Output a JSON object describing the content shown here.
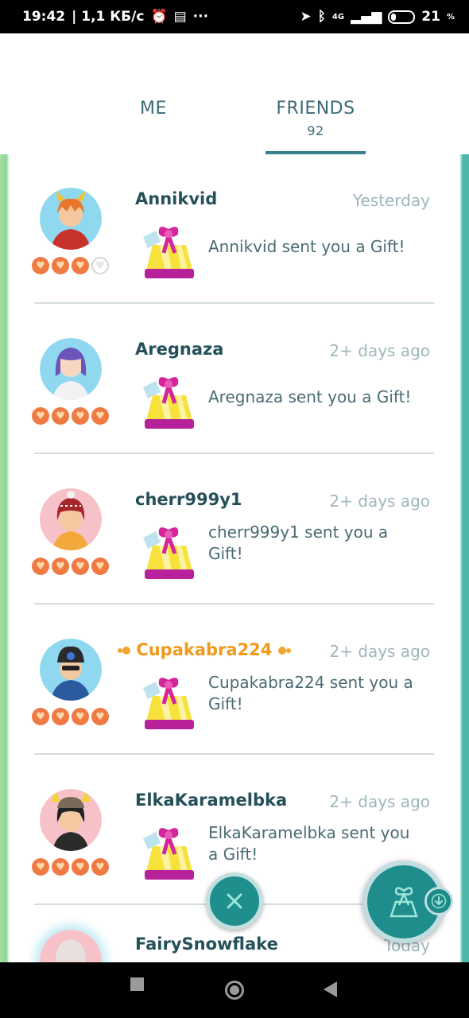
{
  "status_bar": {
    "time": "19:42",
    "speed": "| 1,1 КБ/с",
    "more": "···",
    "network": "4G",
    "battery": "21"
  },
  "tabs": {
    "me": "ME",
    "friends": "FRIENDS",
    "friends_count": "92"
  },
  "friends": [
    {
      "name": "Annikvid",
      "time": "Yesterday",
      "message": "Annikvid sent you a Gift!",
      "hearts_filled": 3,
      "hearts_total": 4,
      "name_color": "#24505a"
    },
    {
      "name": "Aregnaza",
      "time": "2+ days ago",
      "message": "Aregnaza sent you a Gift!",
      "hearts_filled": 4,
      "hearts_total": 4,
      "name_color": "#24505a"
    },
    {
      "name": "cherr999y1",
      "time": "2+ days ago",
      "message": "cherr999y1 sent you a Gift!",
      "hearts_filled": 4,
      "hearts_total": 4,
      "name_color": "#24505a"
    },
    {
      "name": "Cupakabra224",
      "time": "2+ days ago",
      "message": "Cupakabra224 sent you a Gift!",
      "hearts_filled": 4,
      "hearts_total": 4,
      "name_color": "#f09a1c"
    },
    {
      "name": "ElkaKaramelbka",
      "time": "2+ days ago",
      "message": "ElkaKaramelbka sent you a Gift!",
      "hearts_filled": 4,
      "hearts_total": 4,
      "name_color": "#24505a"
    },
    {
      "name": "FairySnowflake",
      "time": "Today"
    }
  ],
  "icons": {
    "close_button": "close-icon",
    "gift_button": "gift-bow-icon",
    "download_badge": "download-arrow-icon"
  },
  "colors": {
    "accent_teal": "#1f8f8e",
    "heart_orange": "#ef7a44",
    "frame_green": "#8fd49d",
    "frame_teal": "#4bb9ab"
  }
}
